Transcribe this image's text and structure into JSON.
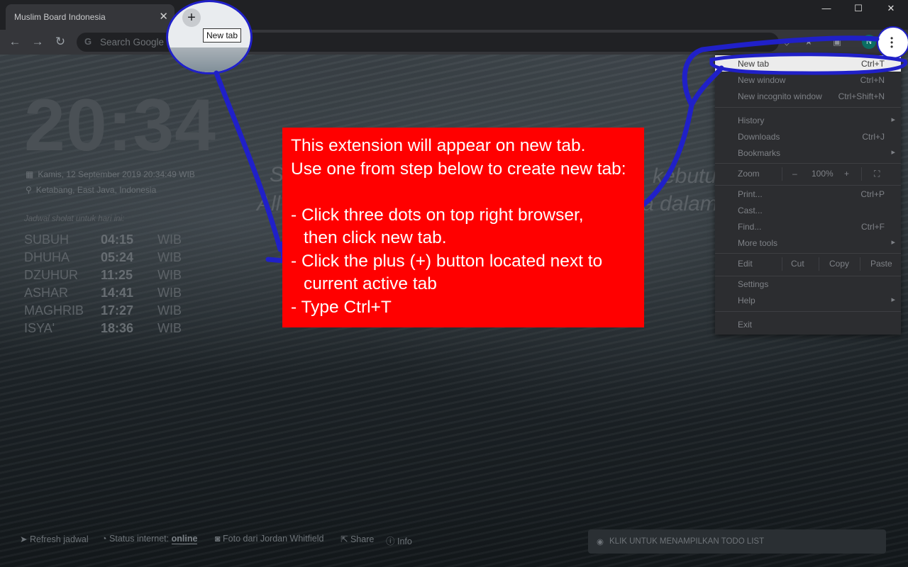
{
  "tab": {
    "title": "Muslim Board Indonesia"
  },
  "newtab_tooltip": "New tab",
  "omnibox": {
    "placeholder": "Search Google or type a URL"
  },
  "avatar_letter": "N",
  "clock": "20:34",
  "date": "Kamis, 12 September 2019 20:34:49 WIB",
  "location": "Ketabang, East Java, Indonesia",
  "prayer": {
    "title": "Jadwal sholat untuk hari ini:",
    "rows": [
      {
        "name": "SUBUH",
        "time": "04:15",
        "tz": "WIB"
      },
      {
        "name": "DHUHA",
        "time": "05:24",
        "tz": "WIB"
      },
      {
        "name": "DZUHUR",
        "time": "11:25",
        "tz": "WIB"
      },
      {
        "name": "ASHAR",
        "time": "14:41",
        "tz": "WIB"
      },
      {
        "name": "MAGHRIB",
        "time": "17:27",
        "tz": "WIB"
      },
      {
        "name": "ISYA'",
        "time": "18:36",
        "tz": "WIB"
      }
    ]
  },
  "quote": {
    "line1_left": "S",
    "line1_right": "kebutu",
    "line2_left": "All",
    "line2_right": "a dalam"
  },
  "footer": {
    "refresh": "Refresh jadwal",
    "status_label": "Status internet:",
    "status_value": "online",
    "photo": "Foto dari Jordan Whitfield",
    "share": "Share",
    "info": "Info"
  },
  "todo_button": "KLIK UNTUK MENAMPILKAN TODO LIST",
  "menu": {
    "new_tab": {
      "label": "New tab",
      "shortcut": "Ctrl+T"
    },
    "new_window": {
      "label": "New window",
      "shortcut": "Ctrl+N"
    },
    "new_incognito": {
      "label": "New incognito window",
      "shortcut": "Ctrl+Shift+N"
    },
    "history": {
      "label": "History"
    },
    "downloads": {
      "label": "Downloads",
      "shortcut": "Ctrl+J"
    },
    "bookmarks": {
      "label": "Bookmarks"
    },
    "zoom": {
      "label": "Zoom",
      "minus": "–",
      "value": "100%",
      "plus": "+"
    },
    "print": {
      "label": "Print...",
      "shortcut": "Ctrl+P"
    },
    "cast": {
      "label": "Cast..."
    },
    "find": {
      "label": "Find...",
      "shortcut": "Ctrl+F"
    },
    "more_tools": {
      "label": "More tools"
    },
    "edit": {
      "label": "Edit",
      "cut": "Cut",
      "copy": "Copy",
      "paste": "Paste"
    },
    "settings": {
      "label": "Settings"
    },
    "help": {
      "label": "Help"
    },
    "exit": {
      "label": "Exit"
    }
  },
  "instructions": {
    "l1": "This extension will appear on new tab.",
    "l2": "Use one from step below to create new tab:",
    "l3": "- Click three dots on top right browser,",
    "l4": "then click new tab.",
    "l5": "- Click the plus (+) button located next to",
    "l6": "current active tab",
    "l7": "- Type Ctrl+T"
  },
  "colors": {
    "annotation": "#2020c8",
    "instruction_bg": "#ff0000",
    "menu_bg": "#2c2d30"
  },
  "icons": {
    "calendar": "calendar-icon",
    "location": "map-pin-icon",
    "refresh": "location-arrow-icon",
    "wifi": "wifi-icon",
    "camera": "camera-icon",
    "share": "share-icon",
    "info": "info-icon",
    "eye": "eye-icon"
  }
}
